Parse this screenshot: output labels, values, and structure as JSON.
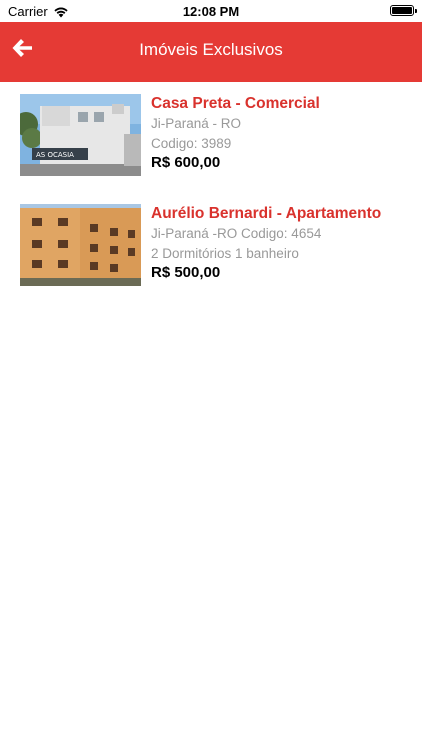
{
  "status_bar": {
    "carrier": "Carrier",
    "time": "12:08 PM"
  },
  "nav": {
    "title": "Imóveis Exclusivos",
    "back_icon": "arrow-left-icon",
    "color": "#e53a35"
  },
  "listings": [
    {
      "title": "Casa Preta - Comercial",
      "line1": "Ji-Paraná - RO",
      "line2": "Codigo: 3989",
      "price": "R$ 600,00",
      "sign_text": "AS OCASIA"
    },
    {
      "title": "Aurélio Bernardi - Apartamento",
      "line1": "Ji-Paraná -RO Codigo: 4654",
      "line2": "2 Dormitórios 1 banheiro",
      "price": "R$ 500,00"
    }
  ],
  "colors": {
    "accent": "#e53a35",
    "title_red": "#d9322d",
    "secondary_text": "#999999"
  }
}
